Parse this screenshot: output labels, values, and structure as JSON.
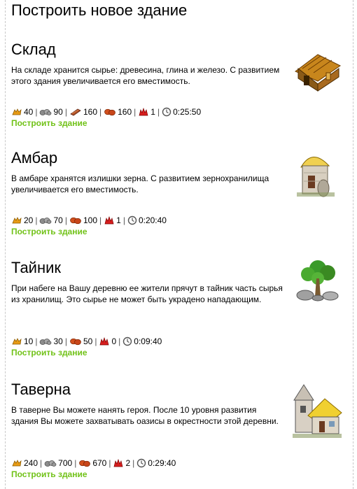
{
  "page": {
    "title": "Построить новое здание"
  },
  "buildings": [
    {
      "name": "Склад",
      "description": "На складе хранится сырье: древесина, глина и железо. С развитием этого здания увеличивается его вместимость.",
      "costs": {
        "wood": "40",
        "clay": "90",
        "iron": "160",
        "crop": "160",
        "upkeep": "1",
        "time": "0:25:50"
      },
      "build_label": "Построить здание",
      "image_icon": "warehouse-icon"
    },
    {
      "name": "Амбар",
      "description": "В амбаре хранятся излишки зерна. С развитием зернохранилища увеличивается его вместимость.",
      "costs": {
        "wood": "20",
        "clay": "70",
        "iron": "",
        "crop": "100",
        "upkeep": "1",
        "time": "0:20:40"
      },
      "build_label": "Построить здание",
      "image_icon": "granary-icon"
    },
    {
      "name": "Тайник",
      "description": "При набеге на Вашу деревню ее жители прячут в тайник часть сырья из хранилищ. Это сырье не может быть украдено нападающим.",
      "costs": {
        "wood": "10",
        "clay": "30",
        "iron": "",
        "crop": "50",
        "upkeep": "0",
        "time": "0:09:40"
      },
      "build_label": "Построить здание",
      "image_icon": "cranny-tree-icon"
    },
    {
      "name": "Таверна",
      "description": "В таверне Вы можете нанять героя. После 10 уровня развития здания Вы можете захватывать оазисы в окрестности этой деревни.",
      "costs": {
        "wood": "240",
        "clay": "700",
        "iron": "",
        "crop": "670",
        "upkeep": "2",
        "time": "0:29:40"
      },
      "build_label": "Построить здание",
      "image_icon": "tavern-icon"
    }
  ],
  "icons": {
    "wood": "wood-icon",
    "clay": "clay-icon",
    "iron": "iron-icon",
    "crop": "crop-icon",
    "upkeep": "upkeep-icon",
    "time": "clock-icon"
  },
  "colors": {
    "link": "#71c218",
    "divider": "#c8c8c8"
  }
}
